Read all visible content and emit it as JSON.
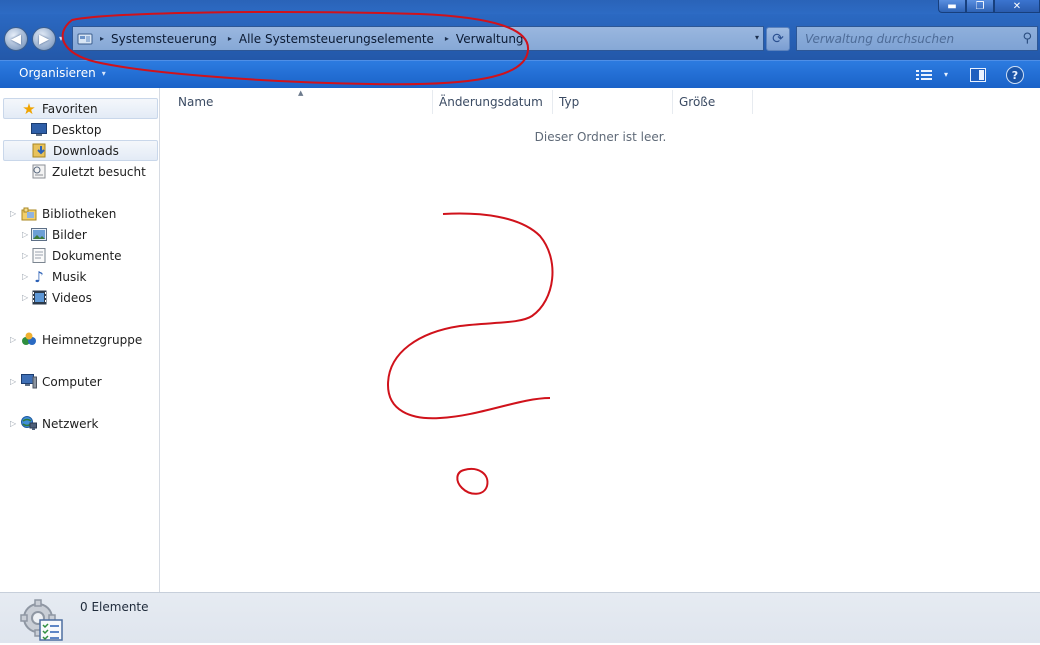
{
  "window": {
    "minimize_symbol": "▬",
    "maximize_symbol": "❐",
    "close_symbol": "✕"
  },
  "nav": {
    "back_symbol": "◀",
    "forward_symbol": "▶",
    "dropdown_symbol": "▾"
  },
  "address": {
    "breadcrumbs": [
      "Systemsteuerung",
      "Alle Systemsteuerungselemente",
      "Verwaltung"
    ],
    "separator": "▸",
    "dropdown_symbol": "▾"
  },
  "search": {
    "placeholder": "Verwaltung durchsuchen"
  },
  "toolbar": {
    "organize_label": "Organisieren",
    "dropdown_symbol": "▾",
    "help_symbol": "?"
  },
  "sidebar": {
    "favorites": {
      "label": "Favoriten",
      "items": [
        "Desktop",
        "Downloads",
        "Zuletzt besucht"
      ]
    },
    "libraries": {
      "label": "Bibliotheken",
      "items": [
        "Bilder",
        "Dokumente",
        "Musik",
        "Videos"
      ]
    },
    "homegroup": "Heimnetzgruppe",
    "computer": "Computer",
    "network": "Netzwerk",
    "selected_item": "Downloads"
  },
  "columns": [
    "Name",
    "Änderungsdatum",
    "Typ",
    "Größe"
  ],
  "content": {
    "empty_message": "Dieser Ordner ist leer."
  },
  "status": {
    "item_count": "0 Elemente"
  },
  "colors": {
    "toolbar_blue": "#1a62c8",
    "address_blue": "#2358a9",
    "annotation_red": "#d0121b",
    "selection_bg": "#e3ebf6"
  }
}
